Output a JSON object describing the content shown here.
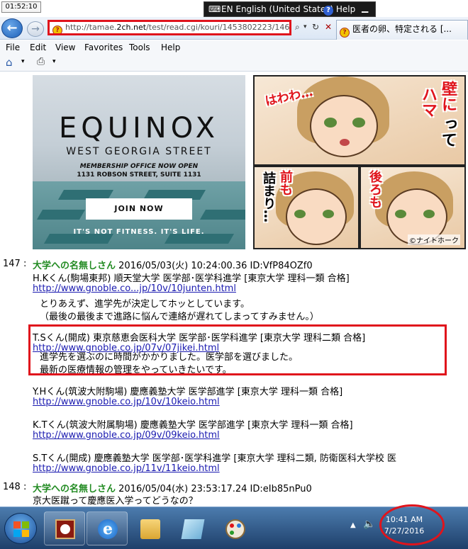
{
  "top_clock": "01:52:10",
  "language_bar": {
    "language": "EN English (United States)",
    "help": "Help"
  },
  "browser": {
    "address": "http://tamae.2ch.net/test/read.cgi/kouri/1453802223/146-n",
    "address_prefix": "http://tamae.",
    "address_domain": "2ch.net",
    "address_path": "/test/read.cgi/kouri/1453802223/146-n",
    "tab_title": "医者の卵、特定される [...",
    "menu": [
      "File",
      "Edit",
      "View",
      "Favorites",
      "Tools",
      "Help"
    ]
  },
  "ads": {
    "left": {
      "logo": "EQUINOX",
      "street": "WEST GEORGIA STREET",
      "line1": "MEMBERSHIP OFFICE NOW OPEN",
      "line2": "1131 ROBSON STREET, SUITE 1131",
      "button": "JOIN NOW",
      "tagline": "IT'S NOT FITNESS. IT'S LIFE."
    },
    "right": {
      "text_hawawa": "はわわ…",
      "text_kabe": "壁に",
      "text_hama": "ハマ",
      "text_tte": "って",
      "text_mae": "前も",
      "text_tsumari": "詰まり…",
      "text_ushiro": "後ろも",
      "copyright": "©ナイトホーク"
    }
  },
  "posts": [
    {
      "number": "147 :",
      "name": "大学への名無しさん",
      "meta": "2016/05/03(火) 10:24:00.36 ID:VfP84OZf0",
      "lines": [
        {
          "type": "text",
          "text": "H.Kくん(駒場東邦) 順天堂大学 医学部･医学科進学 [東京大学 理科一類 合格]"
        },
        {
          "type": "link",
          "text": "http://www.gnoble.co...jp/10v/10junten.html"
        },
        {
          "type": "text",
          "text": "とりあえず、進学先が決定してホッとしています。",
          "indent": true
        },
        {
          "type": "text",
          "text": "（最後の最後まで進路に悩んで連絡が遅れてしまってすみません。）",
          "indent": true
        },
        {
          "type": "text",
          "text": "T.Sくん(開成) 東京慈恵会医科大学 医学部･医学科進学 [東京大学 理科二類 合格]"
        },
        {
          "type": "link",
          "text": "http://www.gnoble.co.jp/07v/07jikei.html"
        },
        {
          "type": "text",
          "text": "進学先を選ぶのに時間がかかりました。医学部を選びました。",
          "indent": true
        },
        {
          "type": "text",
          "text": "最新の医療情報の管理をやっていきたいです。",
          "indent": true
        },
        {
          "type": "text",
          "text": "Y.Hくん(筑波大附駒場) 慶應義塾大学 医学部進学 [東京大学 理科一類 合格]"
        },
        {
          "type": "link",
          "text": "http://www.gnoble.co.jp/10v/10keio.html"
        },
        {
          "type": "text",
          "text": "K.Tくん(筑波大附属駒場) 慶應義塾大学  医学部進学 [東京大学 理科一類 合格]"
        },
        {
          "type": "link",
          "text": "http://www.gnoble.co.jp/09v/09keio.html"
        },
        {
          "type": "text",
          "text": "S.Tくん(開成) 慶應義塾大学 医学部･医学科進学 [東京大学 理科二類, 防衛医科大学校 医"
        },
        {
          "type": "link",
          "text": "http://www.gnoble.co.jp/11v/11keio.html"
        }
      ]
    },
    {
      "number": "148 :",
      "name": "大学への名無しさん",
      "meta": "2016/05/04(水) 23:53:17.24 ID:eIb85nPu0",
      "lines": [
        {
          "type": "text",
          "text": "京大医蹴って慶應医入学ってどうなの？"
        }
      ]
    }
  ],
  "taskbar": {
    "time": "10:41 AM",
    "date": "7/27/2016"
  },
  "colors": {
    "accent_red": "#e0141c",
    "poster_green": "#228b22",
    "link_blue": "#1a1ab0"
  }
}
